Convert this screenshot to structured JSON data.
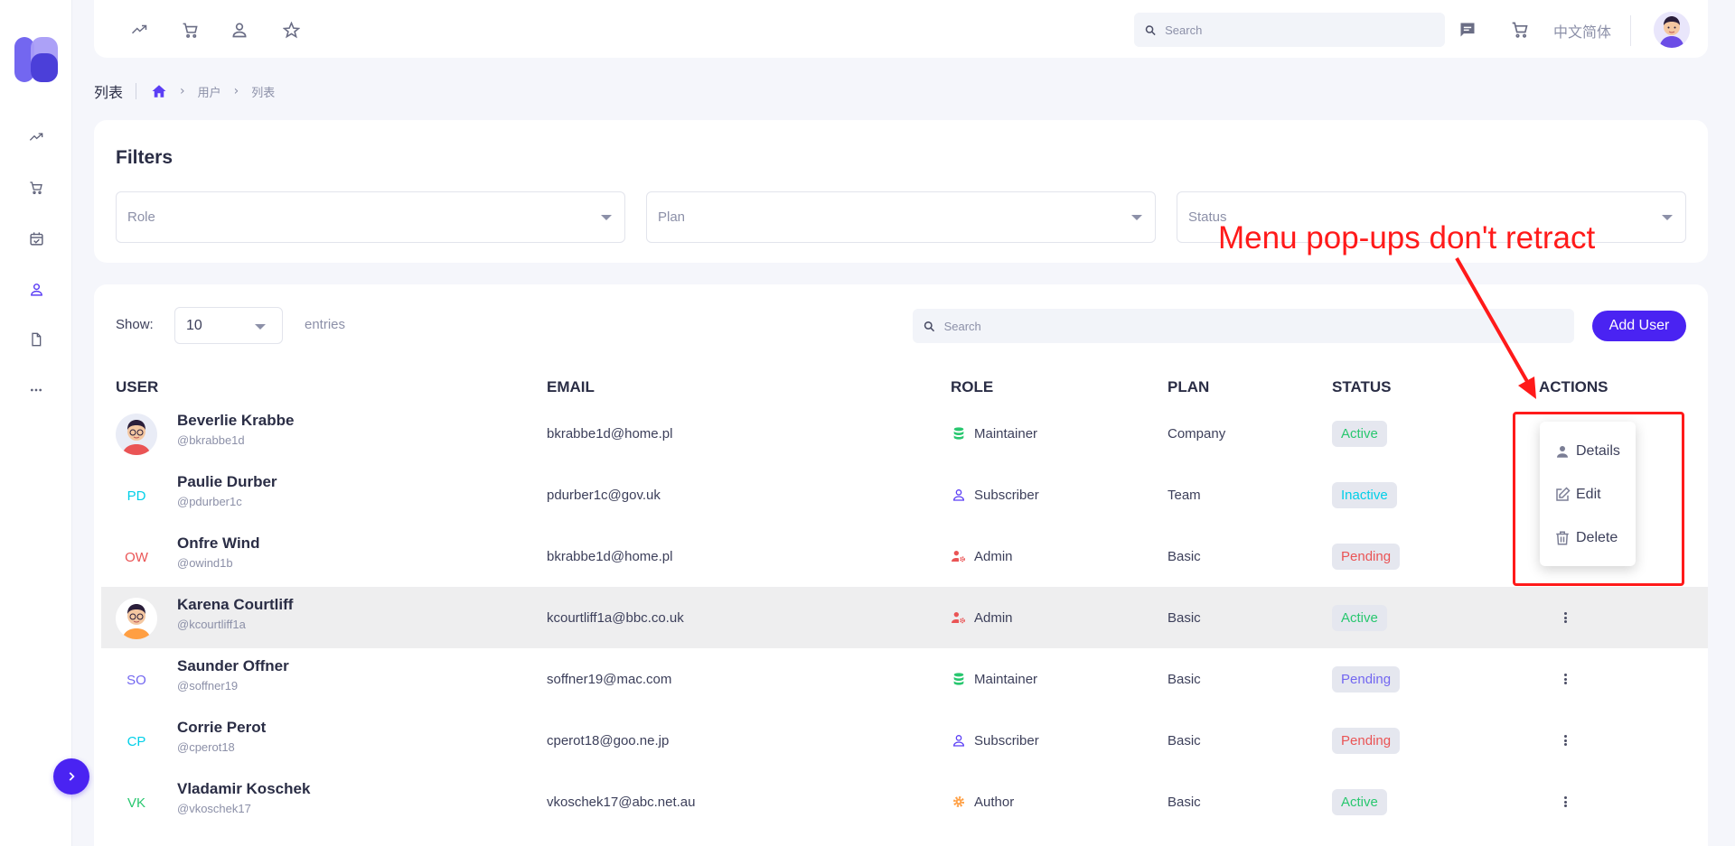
{
  "topbar": {
    "search_placeholder": "Search",
    "language": "中文简体"
  },
  "breadcrumb": {
    "title": "列表",
    "items": [
      "用户",
      "列表"
    ]
  },
  "filters": {
    "title": "Filters",
    "selects": [
      "Role",
      "Plan",
      "Status"
    ]
  },
  "table": {
    "show_label": "Show:",
    "entries_value": "10",
    "entries_label": "entries",
    "search_placeholder": "Search",
    "add_button": "Add User",
    "headers": [
      "USER",
      "EMAIL",
      "ROLE",
      "PLAN",
      "STATUS",
      "ACTIONS"
    ],
    "rows": [
      {
        "name": "Beverlie Krabbe",
        "handle": "@bkrabbe1d",
        "avatar": "photo-red",
        "email": "bkrabbe1d@home.pl",
        "role": "Maintainer",
        "role_icon": "database-icon",
        "plan": "Company",
        "status": "Active"
      },
      {
        "name": "Paulie Durber",
        "handle": "@pdurber1c",
        "avatar": "PD",
        "email": "pdurber1c@gov.uk",
        "role": "Subscriber",
        "role_icon": "user-icon",
        "plan": "Team",
        "status": "Inactive"
      },
      {
        "name": "Onfre Wind",
        "handle": "@owind1b",
        "avatar": "OW",
        "email": "bkrabbe1d@home.pl",
        "role": "Admin",
        "role_icon": "user-cog-icon",
        "plan": "Basic",
        "status": "Pending"
      },
      {
        "name": "Karena Courtliff",
        "handle": "@kcourtliff1a",
        "avatar": "photo-orange",
        "email": "kcourtliff1a@bbc.co.uk",
        "role": "Admin",
        "role_icon": "user-cog-icon",
        "plan": "Basic",
        "status": "Active"
      },
      {
        "name": "Saunder Offner",
        "handle": "@soffner19",
        "avatar": "SO",
        "email": "soffner19@mac.com",
        "role": "Maintainer",
        "role_icon": "database-icon",
        "plan": "Basic",
        "status": "Pending"
      },
      {
        "name": "Corrie Perot",
        "handle": "@cperot18",
        "avatar": "CP",
        "email": "cperot18@goo.ne.jp",
        "role": "Subscriber",
        "role_icon": "user-icon",
        "plan": "Basic",
        "status": "Pending"
      },
      {
        "name": "Vladamir Koschek",
        "handle": "@vkoschek17",
        "avatar": "VK",
        "email": "vkoschek17@abc.net.au",
        "role": "Author",
        "role_icon": "gear-icon",
        "plan": "Basic",
        "status": "Active"
      }
    ]
  },
  "menu": {
    "items": [
      "Details",
      "Edit",
      "Delete"
    ]
  },
  "annotation": {
    "text": "Menu pop-ups don't retract"
  },
  "colors": {
    "primary": "#4a23f2",
    "annotation": "#ff1a1a",
    "active": "#28c76f",
    "pending": "#ea5455",
    "inactive": "#00cfe8"
  }
}
